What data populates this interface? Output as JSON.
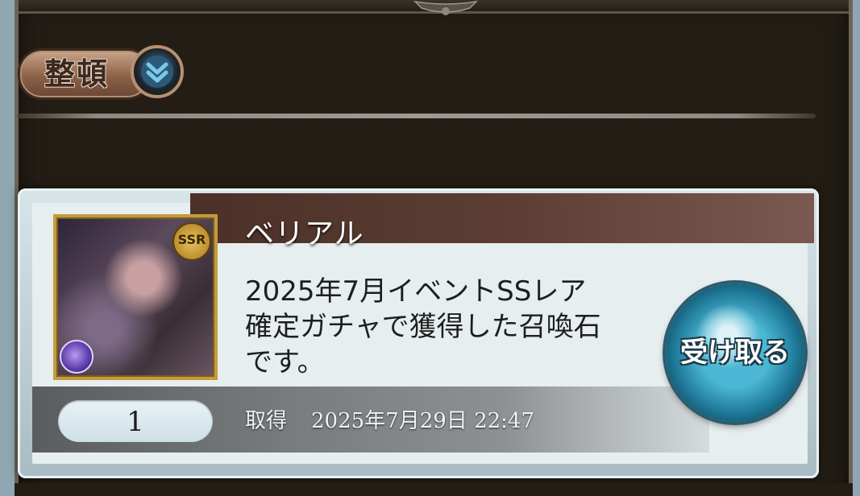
{
  "toolbar": {
    "sort_label": "整頓",
    "sort_icon": "chevron-double-down-icon"
  },
  "item": {
    "name": "ベリアル",
    "rarity": "SSR",
    "description": "2025年7月イベントSSレア\n確定ガチャで獲得した召喚石\nです。",
    "quantity": "1",
    "acquired_label": "取得",
    "acquired_date": "2025年7月29日 22:47",
    "receive_label": "受け取る"
  },
  "colors": {
    "frame": "#231d16",
    "sort_button": "#8b6248",
    "name_band": "#4c3128",
    "receive_button": "#2b93b4"
  }
}
